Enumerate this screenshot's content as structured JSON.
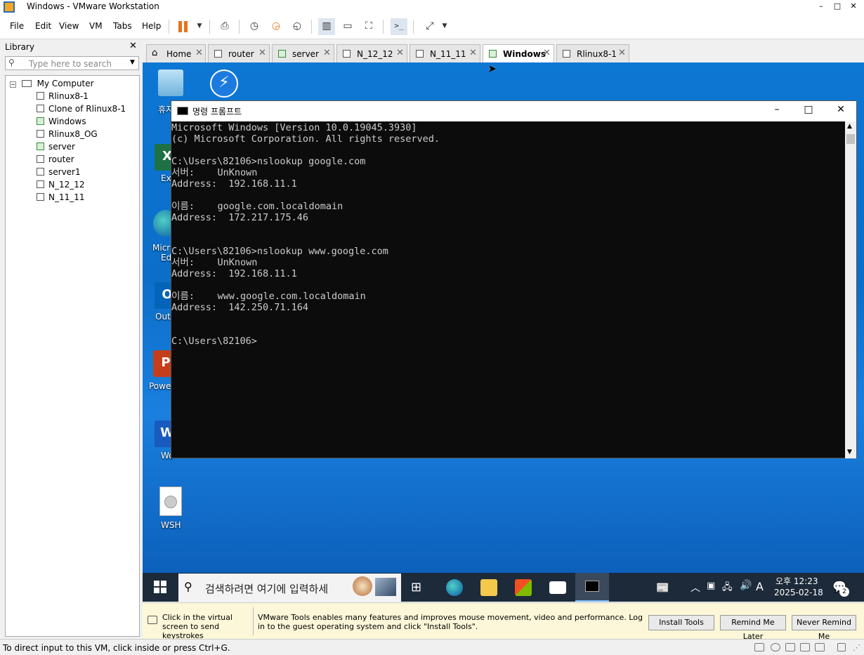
{
  "window": {
    "title": "Windows - VMware Workstation",
    "minimize": "–",
    "maximize": "□",
    "close": "✕"
  },
  "menu": [
    "File",
    "Edit",
    "View",
    "VM",
    "Tabs",
    "Help"
  ],
  "library": {
    "title": "Library",
    "close": "✕",
    "search_placeholder": "Type here to search",
    "root": "My Computer",
    "items": [
      "Rlinux8-1",
      "Clone of Rlinux8-1",
      "Windows",
      "Rlinux8_OG",
      "server",
      "router",
      "server1",
      "N_12_12",
      "N_11_11"
    ],
    "running": [
      "Windows",
      "server"
    ]
  },
  "tabs": [
    "Home",
    "router",
    "server",
    "N_12_12",
    "N_11_11",
    "Windows",
    "Rlinux8-1"
  ],
  "active_tab": "Windows",
  "desktop": {
    "labels": [
      "휴지",
      "Ex",
      "Micr",
      "Ed",
      "Out",
      "Powe",
      "Wo",
      "WSH"
    ]
  },
  "cmd": {
    "title": "명령 프롬프트",
    "lines": [
      "Microsoft Windows [Version 10.0.19045.3930]",
      "(c) Microsoft Corporation. All rights reserved.",
      "",
      "C:\\Users\\82106>nslookup google.com",
      "서버:    UnKnown",
      "Address:  192.168.11.1",
      "",
      "이름:    google.com.localdomain",
      "Address:  172.217.175.46",
      "",
      "",
      "C:\\Users\\82106>nslookup www.google.com",
      "서버:    UnKnown",
      "Address:  192.168.11.1",
      "",
      "이름:    www.google.com.localdomain",
      "Address:  142.250.71.164",
      "",
      "",
      "C:\\Users\\82106>"
    ]
  },
  "taskbar": {
    "search_placeholder": "검색하려면 여기에 입력하세",
    "ime": "A",
    "time_line1": "오후 12:23",
    "time_line2": "2025-02-18",
    "notification_count": "2"
  },
  "tools_bar": {
    "hint": "Click in the virtual screen to send keystrokes",
    "message": "VMware Tools enables many features and improves mouse movement, video and performance. Log in to the guest operating system and click \"Install Tools\".",
    "install": "Install Tools",
    "remind_later": "Remind Me Later",
    "never_remind": "Never Remind Me"
  },
  "status": {
    "text": "To direct input to this VM, click inside or press Ctrl+G."
  },
  "colors": {
    "pause": "#e8731a",
    "desktop": "#0c6ec8",
    "taskbar": "#1c2a3a",
    "tools_bar": "#fbf7d8"
  }
}
